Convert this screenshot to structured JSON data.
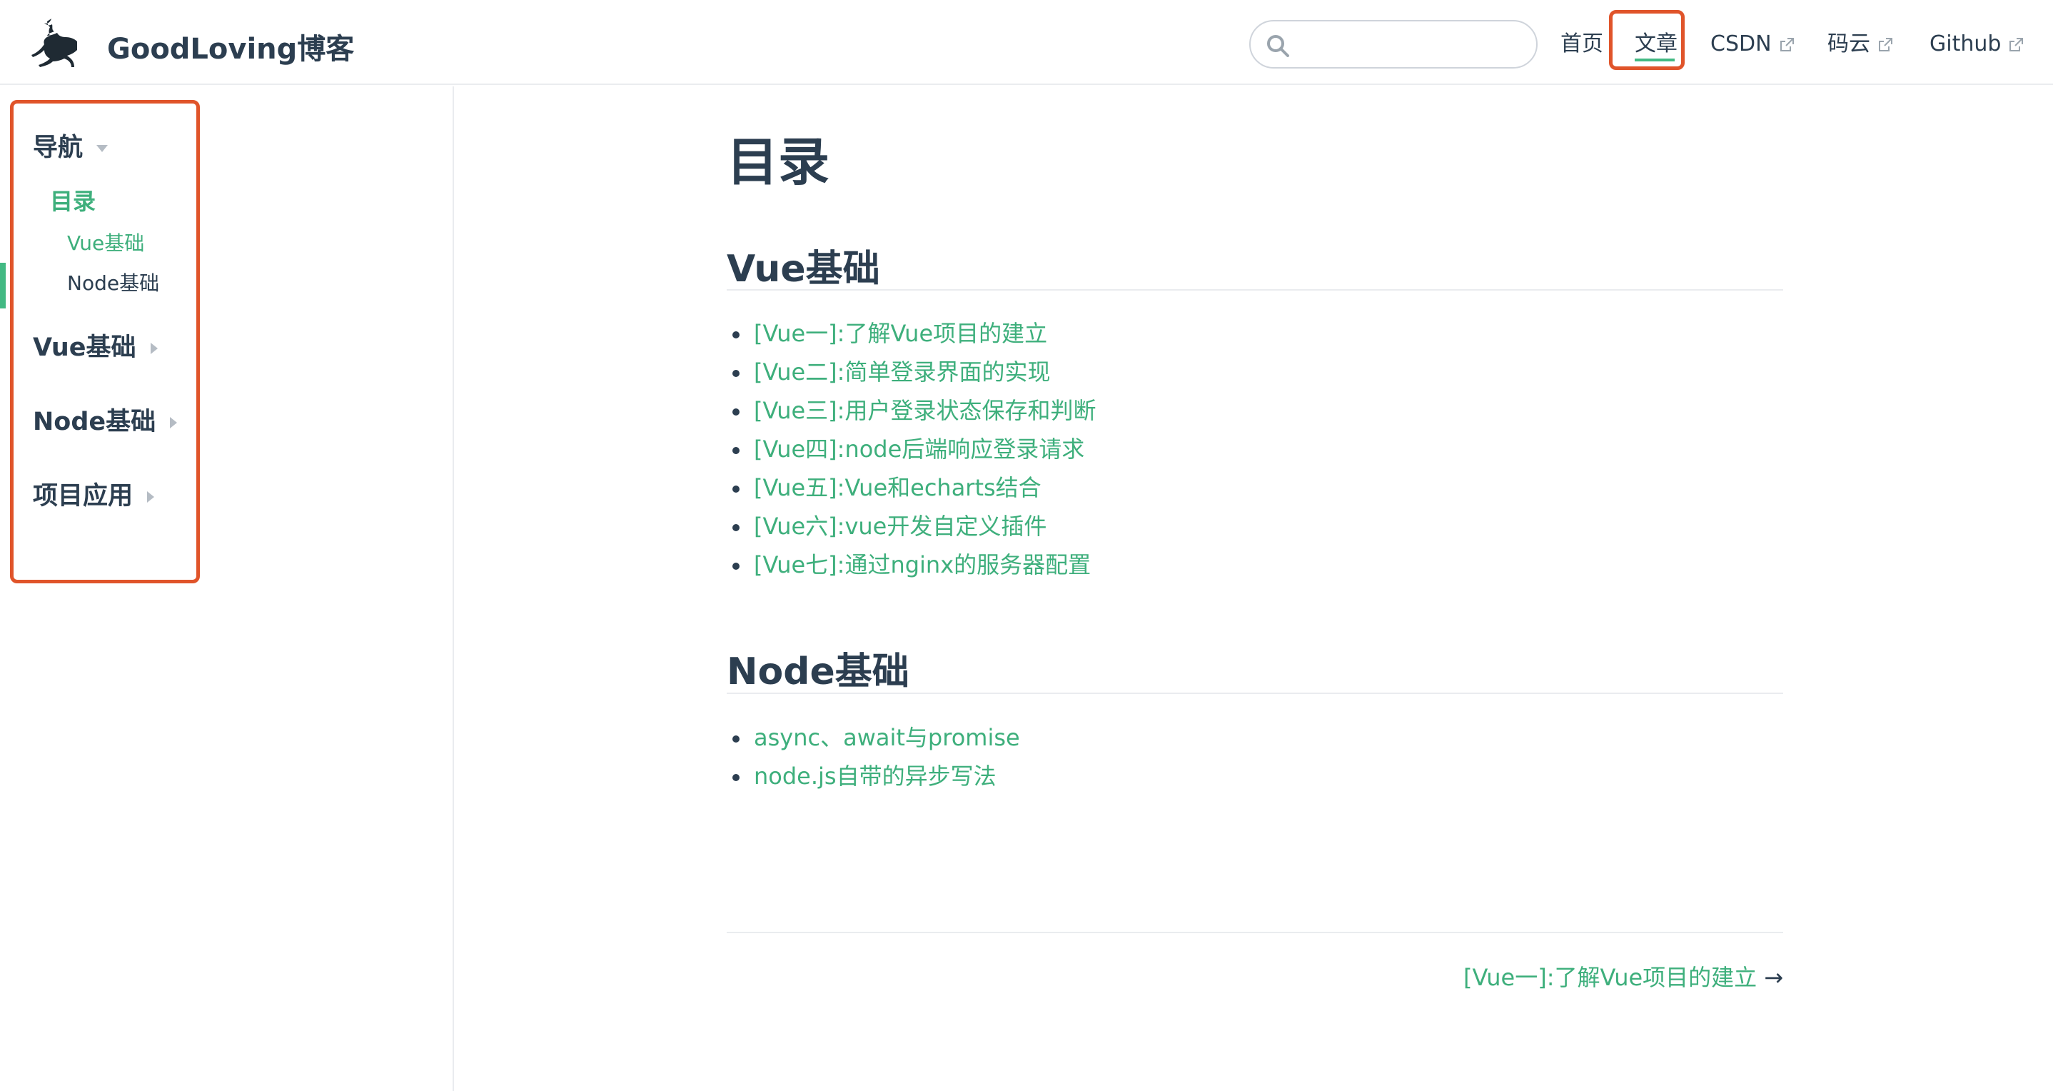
{
  "header": {
    "site_name": "GoodLoving博客",
    "search": {
      "placeholder": "",
      "value": ""
    },
    "nav": [
      {
        "label": "首页",
        "external": false,
        "active": false
      },
      {
        "label": "文章",
        "external": false,
        "active": true
      },
      {
        "label": "CSDN",
        "external": true,
        "active": false
      },
      {
        "label": "码云",
        "external": true,
        "active": false
      },
      {
        "label": "Github",
        "external": true,
        "active": false
      }
    ]
  },
  "sidebar": {
    "groups": [
      {
        "title": "导航",
        "expanded": true,
        "children": [
          {
            "label": "目录",
            "active": true,
            "level": 1
          },
          {
            "label": "Vue基础",
            "active": true,
            "level": 2
          },
          {
            "label": "Node基础",
            "active": false,
            "level": 2
          }
        ]
      },
      {
        "title": "Vue基础",
        "expanded": false
      },
      {
        "title": "Node基础",
        "expanded": false
      },
      {
        "title": "项目应用",
        "expanded": false
      }
    ]
  },
  "content": {
    "title": "目录",
    "sections": [
      {
        "heading": "Vue基础",
        "links": [
          "[Vue一]:了解Vue项目的建立",
          "[Vue二]:简单登录界面的实现",
          "[Vue三]:用户登录状态保存和判断",
          "[Vue四]:node后端响应登录请求",
          "[Vue五]:Vue和echarts结合",
          "[Vue六]:vue开发自定义插件",
          "[Vue七]:通过nginx的服务器配置"
        ]
      },
      {
        "heading": "Node基础",
        "links": [
          "async、await与promise",
          "node.js自带的异步写法"
        ]
      }
    ],
    "next_page": {
      "label": "[Vue一]:了解Vue项目的建立",
      "arrow": "→"
    }
  },
  "colors": {
    "accent": "#3eaf7c",
    "text": "#2c3e50",
    "highlight": "#e0542a",
    "border": "#eaecef"
  },
  "icons": {
    "logo": "deer-logo-icon",
    "search": "search-icon",
    "external": "external-link-icon",
    "expanded": "triangle-down-icon",
    "collapsed": "triangle-right-icon"
  }
}
